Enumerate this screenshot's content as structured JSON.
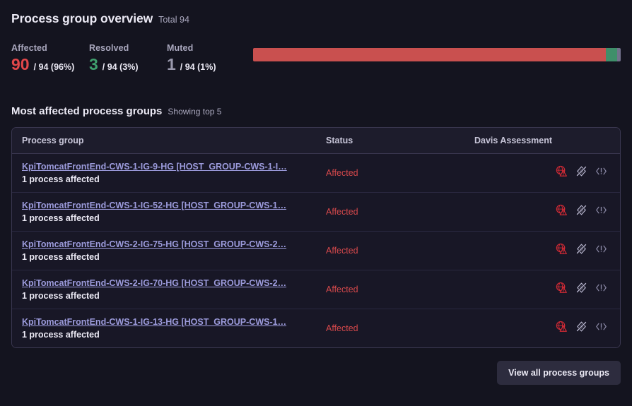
{
  "overview": {
    "title": "Process group overview",
    "total_label": "Total 94",
    "stats": [
      {
        "label": "Affected",
        "value": "90",
        "rest": "/ 94 (96%)",
        "color": "#e2474a",
        "percent": 96
      },
      {
        "label": "Resolved",
        "value": "3",
        "rest": "/ 94 (3%)",
        "color": "#3f9e6d",
        "percent": 3
      },
      {
        "label": "Muted",
        "value": "1",
        "rest": "/ 94 (1%)",
        "color": "#9a99ad",
        "percent": 1
      }
    ],
    "bar": {
      "affected_color": "#c9504f",
      "resolved_color": "#3f8f6a",
      "muted_color": "#73728c"
    }
  },
  "section": {
    "title": "Most affected process groups",
    "subtitle": "Showing top 5"
  },
  "table": {
    "columns": [
      "Process group",
      "Status",
      "Davis Assessment"
    ],
    "rows": [
      {
        "name": "KpiTomcatFrontEnd-CWS-1-IG-9-HG [HOST_GROUP-CWS-1-I…",
        "sub": "1 process affected",
        "status": "Affected",
        "icons": [
          "globe-problem-icon",
          "davis-off-icon",
          "alert-code-icon"
        ]
      },
      {
        "name": "KpiTomcatFrontEnd-CWS-1-IG-52-HG [HOST_GROUP-CWS-1…",
        "sub": "1 process affected",
        "status": "Affected",
        "icons": [
          "globe-problem-icon",
          "davis-off-icon",
          "alert-code-icon"
        ]
      },
      {
        "name": "KpiTomcatFrontEnd-CWS-2-IG-75-HG [HOST_GROUP-CWS-2…",
        "sub": "1 process affected",
        "status": "Affected",
        "icons": [
          "globe-problem-icon",
          "davis-off-icon",
          "alert-code-icon"
        ]
      },
      {
        "name": "KpiTomcatFrontEnd-CWS-2-IG-70-HG [HOST_GROUP-CWS-2…",
        "sub": "1 process affected",
        "status": "Affected",
        "icons": [
          "globe-problem-icon",
          "davis-off-icon",
          "alert-code-icon"
        ]
      },
      {
        "name": "KpiTomcatFrontEnd-CWS-1-IG-13-HG [HOST_GROUP-CWS-1…",
        "sub": "1 process affected",
        "status": "Affected",
        "icons": [
          "globe-problem-icon",
          "davis-off-icon",
          "alert-code-icon"
        ]
      }
    ]
  },
  "footer": {
    "view_all_label": "View all process groups"
  }
}
